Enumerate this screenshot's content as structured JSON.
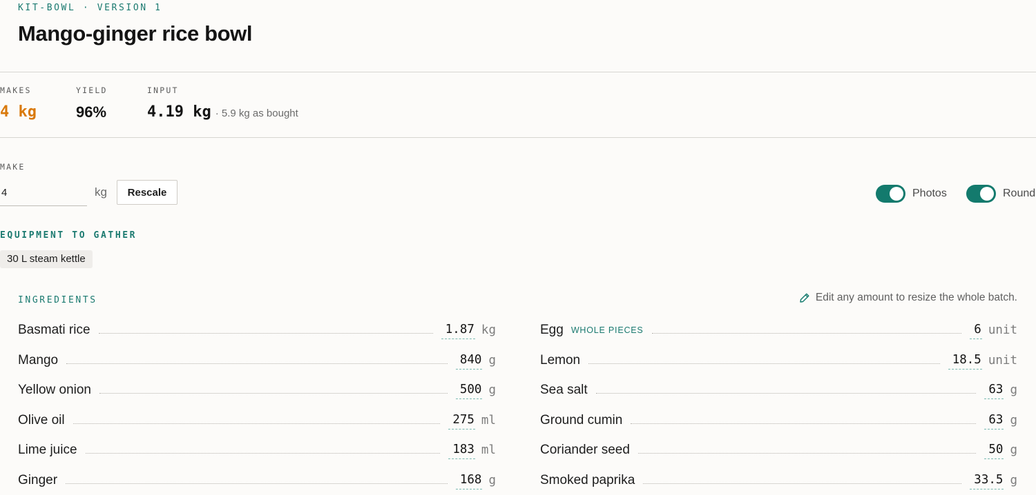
{
  "header": {
    "eyebrow": "KIT-BOWL · VERSION 1",
    "title": "Mango-ginger rice bowl"
  },
  "stats": {
    "makes": {
      "label": "MAKES",
      "value": "4 kg"
    },
    "yield": {
      "label": "YIELD",
      "value": "96%"
    },
    "input": {
      "label": "INPUT",
      "value": "4.19 kg",
      "note": "· 5.9 kg as bought"
    }
  },
  "make": {
    "label": "MAKE",
    "value": "4",
    "unit": "kg",
    "rescale_label": "Rescale"
  },
  "toggles": [
    {
      "label": "Photos",
      "on": true
    },
    {
      "label": "Round",
      "on": true
    }
  ],
  "equipment": {
    "heading": "EQUIPMENT TO GATHER",
    "items": [
      "30 L steam kettle"
    ]
  },
  "ingredients": {
    "heading": "INGREDIENTS",
    "hint": "Edit any amount to resize the whole batch.",
    "left": [
      {
        "name": "Basmati rice",
        "amount": "1.87",
        "unit": "kg"
      },
      {
        "name": "Mango",
        "amount": "840",
        "unit": "g"
      },
      {
        "name": "Yellow onion",
        "amount": "500",
        "unit": "g"
      },
      {
        "name": "Olive oil",
        "amount": "275",
        "unit": "ml"
      },
      {
        "name": "Lime juice",
        "amount": "183",
        "unit": "ml"
      },
      {
        "name": "Ginger",
        "amount": "168",
        "unit": "g"
      }
    ],
    "right": [
      {
        "name": "Egg",
        "tag": "WHOLE PIECES",
        "amount": "6",
        "unit": "unit"
      },
      {
        "name": "Lemon",
        "amount": "18.5",
        "unit": "unit"
      },
      {
        "name": "Sea salt",
        "amount": "63",
        "unit": "g"
      },
      {
        "name": "Ground cumin",
        "amount": "63",
        "unit": "g"
      },
      {
        "name": "Coriander seed",
        "amount": "50",
        "unit": "g"
      },
      {
        "name": "Smoked paprika",
        "amount": "33.5",
        "unit": "g"
      }
    ]
  },
  "colors": {
    "accent": "#d9790b",
    "teal": "#137a6d",
    "background": "#fcfbf9"
  }
}
